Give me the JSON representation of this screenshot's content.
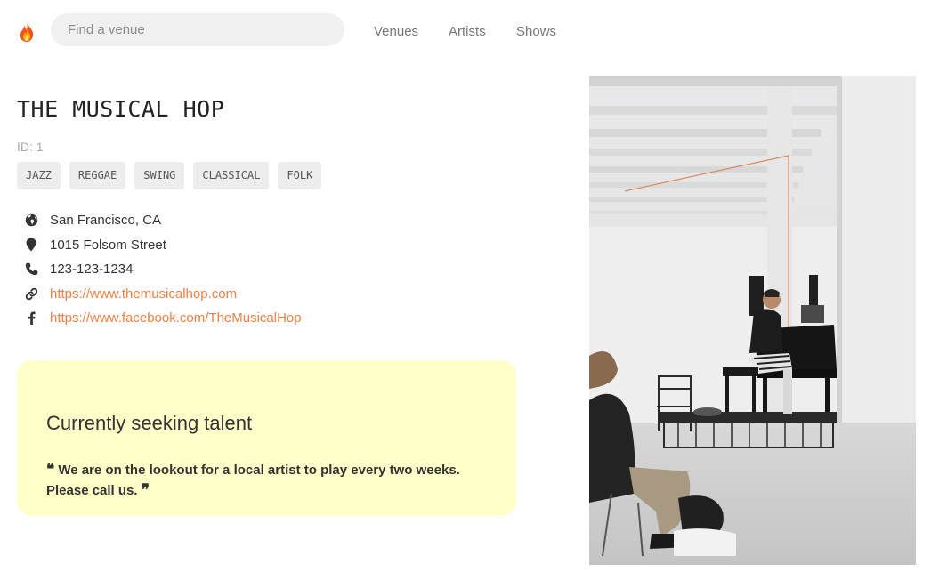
{
  "header": {
    "logo_icon": "flame-icon",
    "search_placeholder": "Find a venue",
    "nav": [
      "Venues",
      "Artists",
      "Shows"
    ]
  },
  "venue": {
    "name": "THE MUSICAL HOP",
    "id_label": "ID: 1",
    "genres": [
      "JAZZ",
      "REGGAE",
      "SWING",
      "CLASSICAL",
      "FOLK"
    ],
    "location": "San Francisco, CA",
    "address": "1015 Folsom Street",
    "phone": "123-123-1234",
    "website": "https://www.themusicalhop.com",
    "facebook": "https://www.facebook.com/TheMusicalHop"
  },
  "seeking": {
    "heading": "Currently seeking talent",
    "description": "We are on the lookout for a local artist to play every two weeks. Please call us."
  },
  "icons": {
    "location": "globe-icon",
    "address": "map-marker-icon",
    "phone": "phone-icon",
    "website": "link-icon",
    "facebook": "facebook-icon",
    "quote_open": "quote-left-icon",
    "quote_close": "quote-right-icon"
  },
  "colors": {
    "link": "#f07f45",
    "seeking_card": "#ffffc9",
    "tag_bg": "#ededed"
  }
}
